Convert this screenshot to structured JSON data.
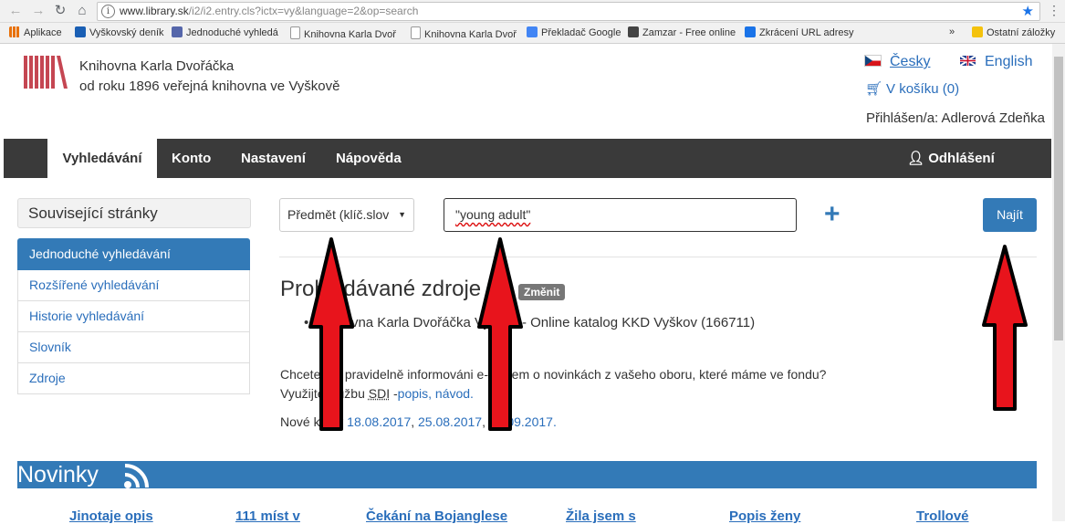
{
  "browser": {
    "url_host": "www.library.sk",
    "url_path": "/i2/i2.entry.cls?ictx=vy&language=2&op=search",
    "bookmarks": [
      {
        "label": "Aplikace",
        "color": "#e8710a"
      },
      {
        "label": "Vyškovský deník",
        "color": "#1a5fb4"
      },
      {
        "label": "Jednoduché vyhledá ",
        "color": "#5566aa"
      },
      {
        "label": "Knihovna Karla Dvoř ",
        "color": "#bbbbbb"
      },
      {
        "label": "Knihovna Karla Dvoř ",
        "color": "#bbbbbb"
      },
      {
        "label": "Překladač Google",
        "color": "#4285f4"
      },
      {
        "label": "Zamzar - Free online",
        "color": "#444444"
      },
      {
        "label": "Zkrácení URL adresy",
        "color": "#1a73e8"
      },
      {
        "label": "Ostatní záložky",
        "color": "#f4c20d"
      }
    ],
    "more_bookmarks": "»"
  },
  "header": {
    "library_name": "Knihovna Karla Dvořáčka",
    "library_tagline": "od roku 1896 veřejná knihovna ve Vyškově",
    "lang_czech": "Česky",
    "lang_english": "English",
    "cart": "V košíku (0)",
    "logged_in": "Přihlášen/a: Adlerová Zdeňka"
  },
  "nav": {
    "search": "Vyhledávání",
    "account": "Konto",
    "settings": "Nastavení",
    "help": "Nápověda",
    "logout": "Odhlášení"
  },
  "sidebar": {
    "heading": "Související stránky",
    "items": [
      {
        "label": "Jednoduché vyhledávání"
      },
      {
        "label": "Rozšířené vyhledávání"
      },
      {
        "label": "Historie vyhledávání"
      },
      {
        "label": "Slovník"
      },
      {
        "label": "Zdroje"
      }
    ]
  },
  "search": {
    "field_select": "Předmět (klíč.slov",
    "query": "\"young adult\"",
    "find_button": "Najít",
    "plus": "+"
  },
  "sources": {
    "title": "Prohledávané zdroje",
    "change_button": "Změnit",
    "item": "Knihovna Karla Dvořáčka Vyškov - Online katalog KKD Vyškov (166711)"
  },
  "info": {
    "line1": "Chcete být pravidelně informováni e-mailem o novinkách z vašeho oboru, které máme ve fondu?",
    "line2_prefix": "Využijte službu ",
    "line2_sdi": "SDI",
    "line2_mid": " -",
    "line2_link": "popis, návod.",
    "new_books_label": "Nové knihy ",
    "new_books_links": [
      "18.08.2017",
      "25.08.2017",
      "01.09.2017."
    ]
  },
  "novinky": {
    "title": "Novinky",
    "books": [
      "Jinotaje opis",
      "111 míst v",
      "Čekání na Bojanglese",
      "Žila jsem s",
      "Popis ženy",
      "Trollové"
    ]
  },
  "colors": {
    "accent": "#337ab7",
    "arrow": "#e8141c",
    "navbar": "#3a3a3a"
  }
}
